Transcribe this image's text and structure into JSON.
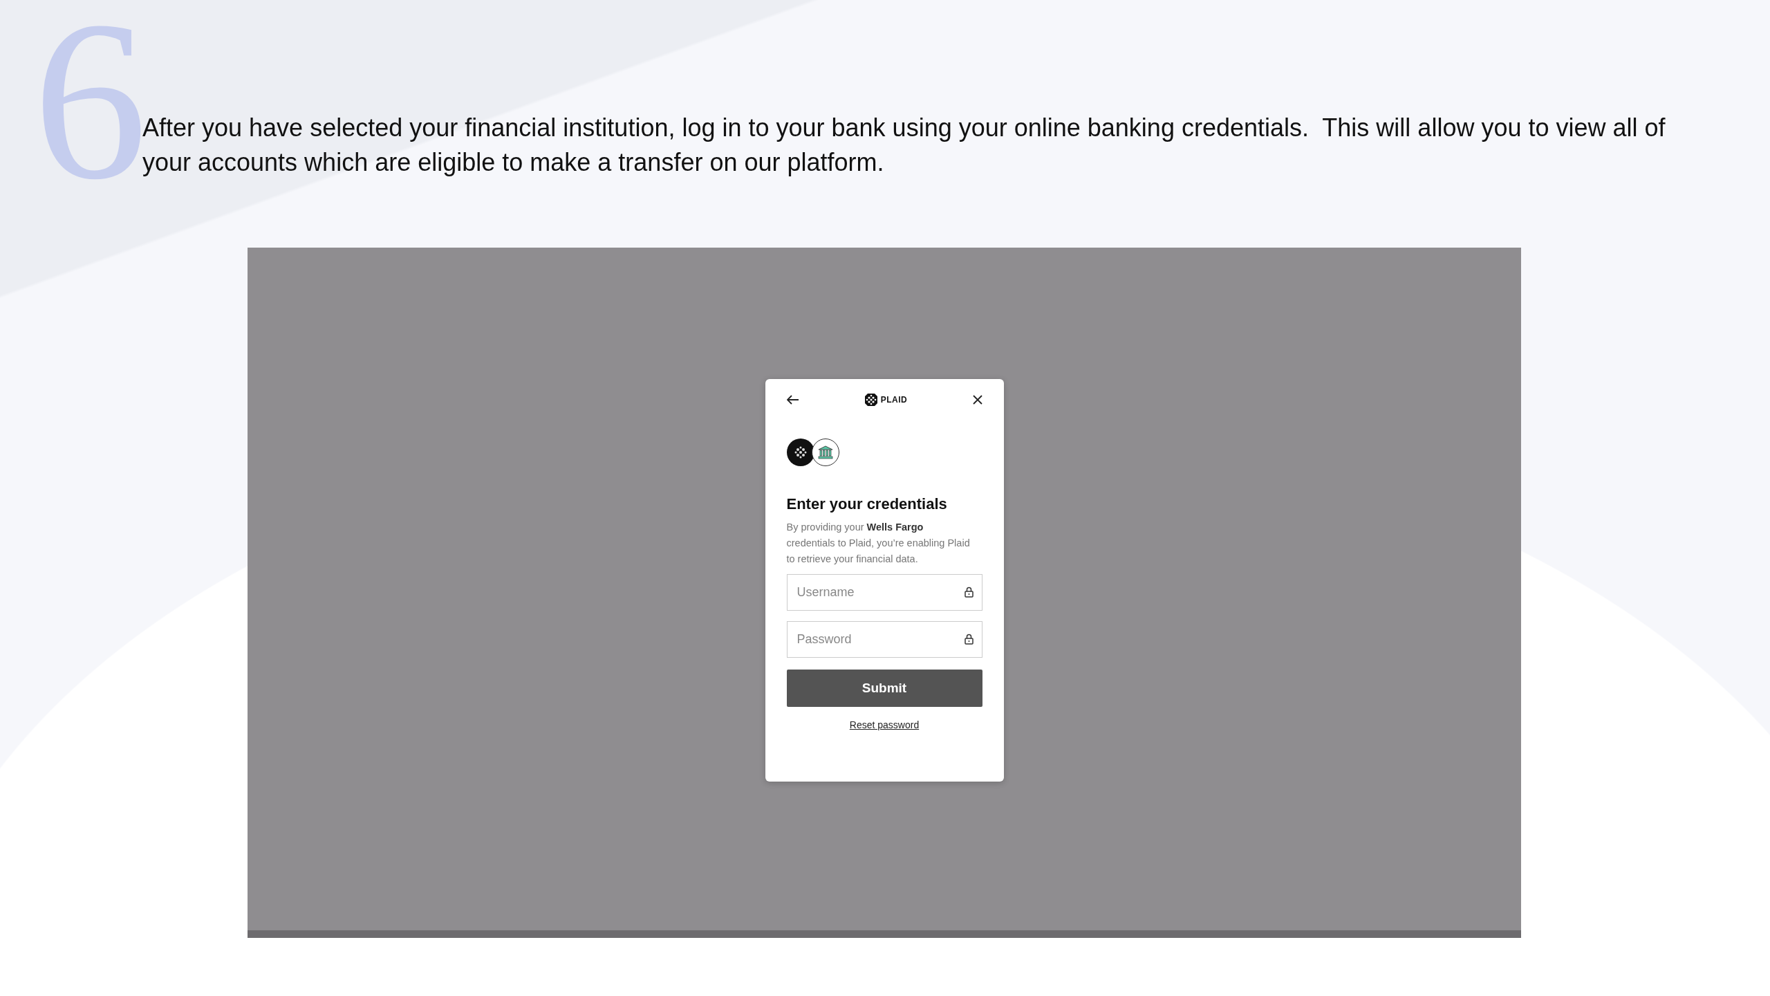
{
  "step_number": "6",
  "instruction": "After you have selected your financial institution, log in to your bank using your online banking credentials.  This will allow you to view all of your accounts which are eligible to make a transfer on our platform.",
  "screenshot": {
    "modal": {
      "logo_text": "PLAID",
      "title": "Enter your credentials",
      "description": "By providing your **Wells Fargo** credentials to Plaid, you’re enabling Plaid to retrieve your financial data.",
      "fields": [
        {
          "placeholder": "Username"
        },
        {
          "placeholder": "Password"
        }
      ],
      "submit": "Submit",
      "link": "Reset password"
    }
  }
}
